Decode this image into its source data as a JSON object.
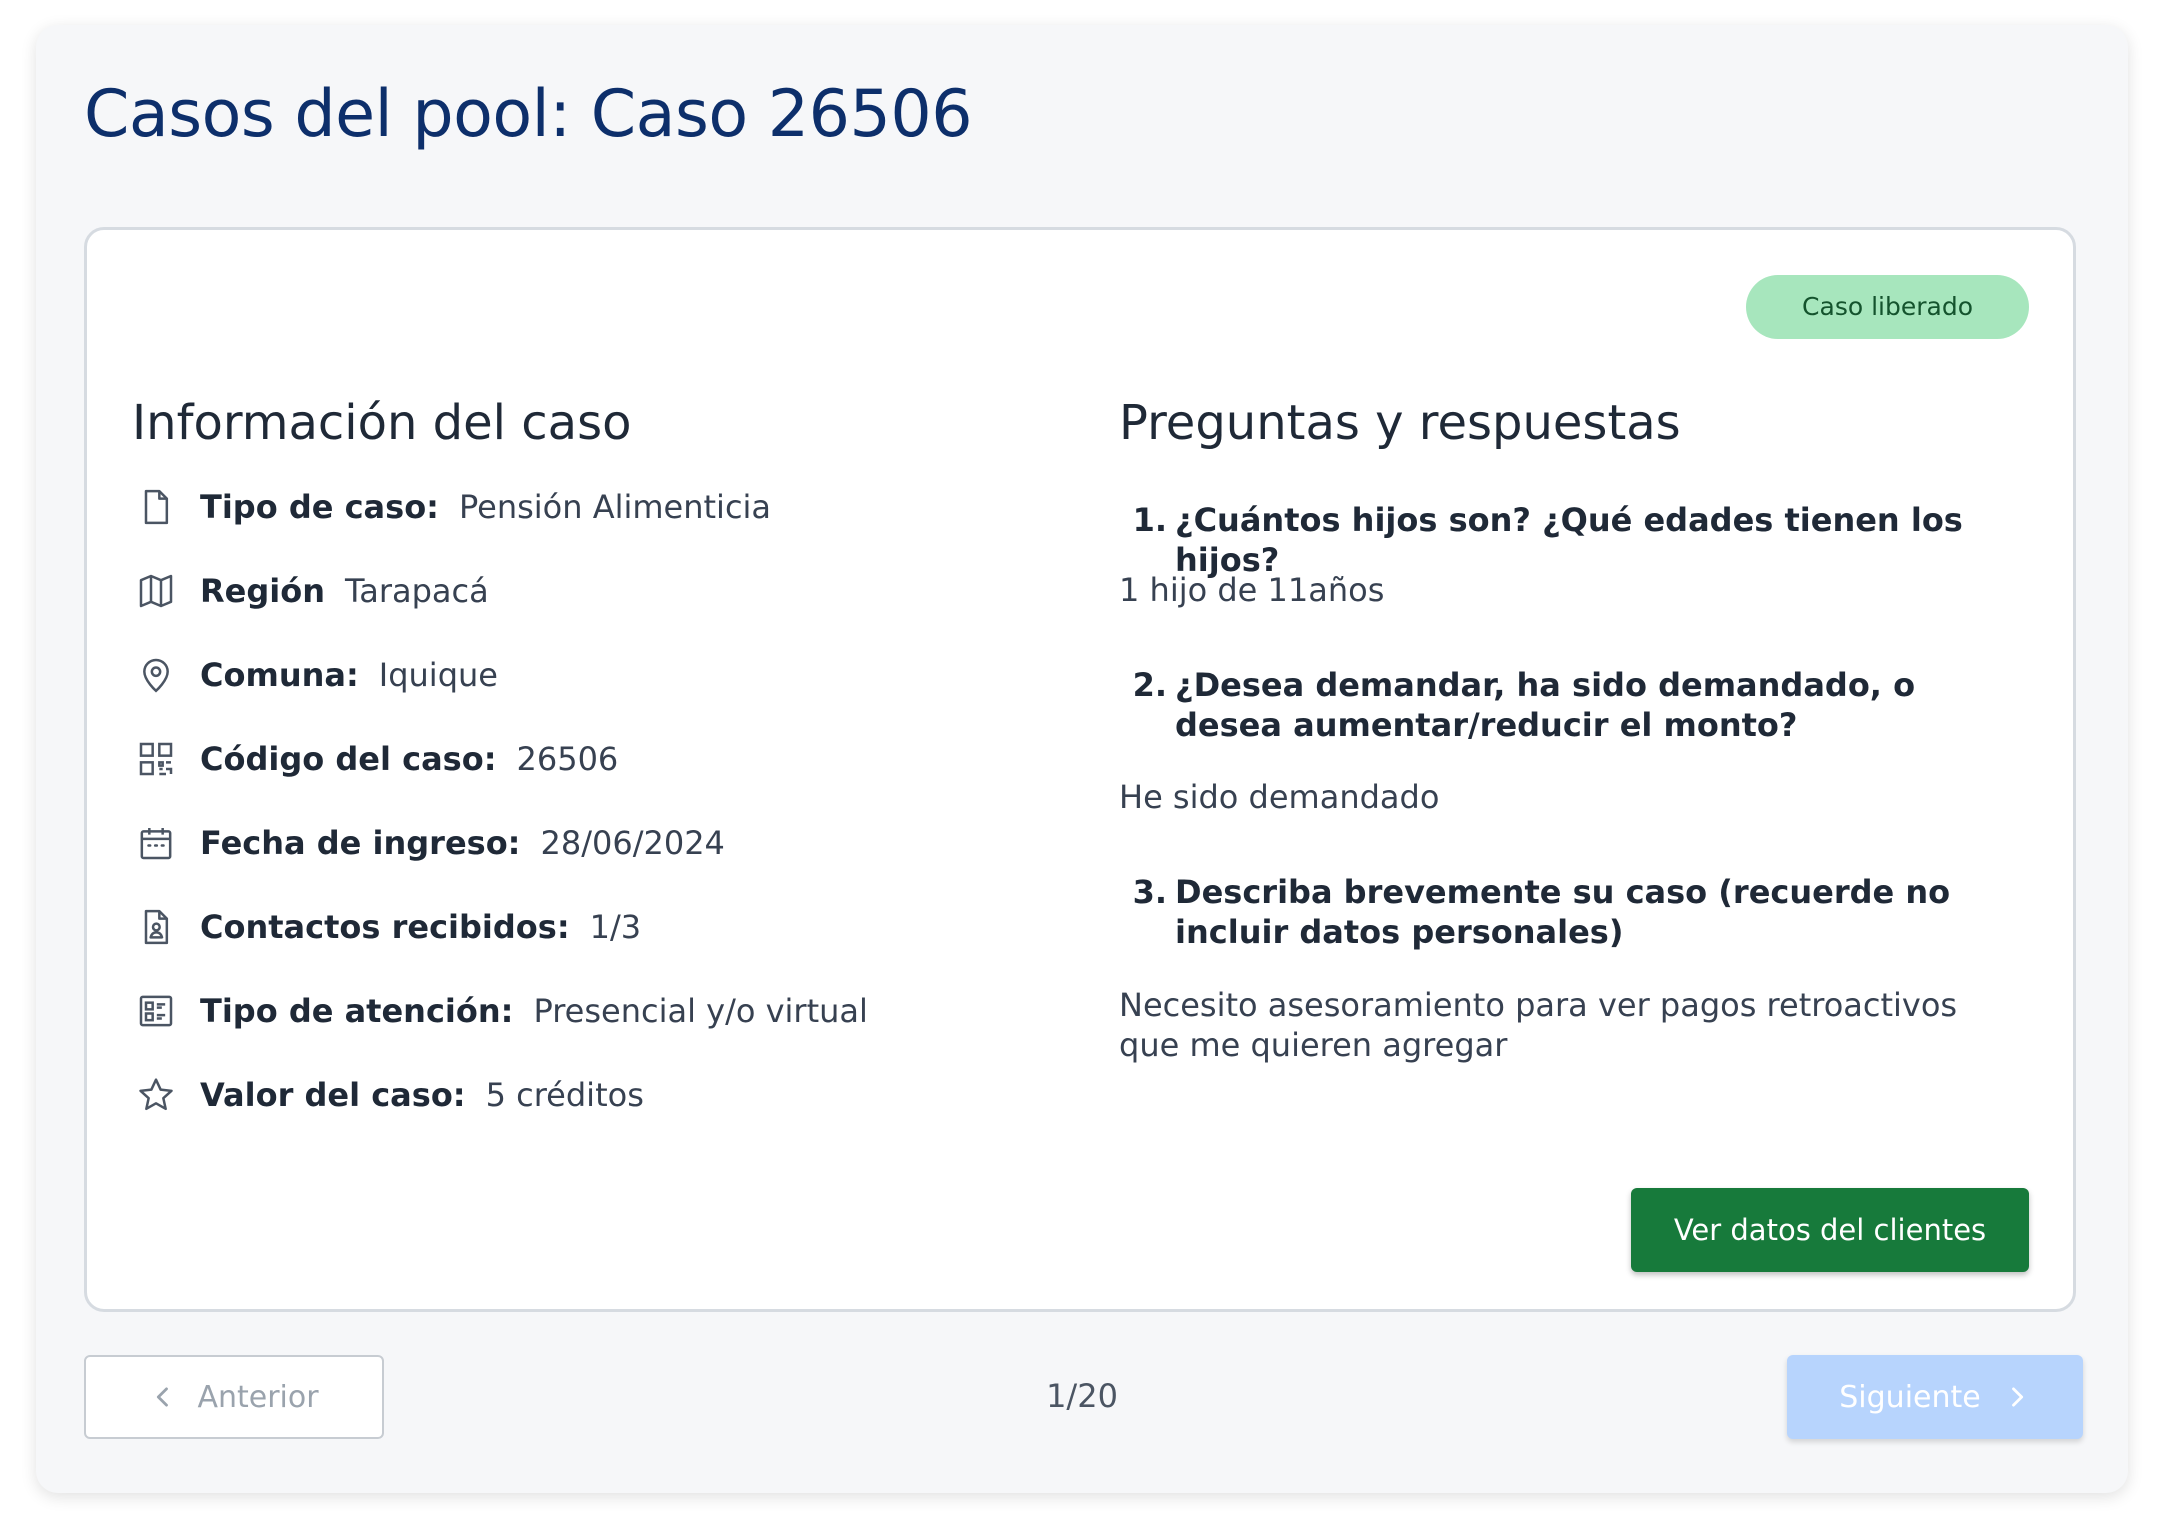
{
  "page": {
    "title": "Casos del pool: Caso 26506"
  },
  "status_badge": "Caso liberado",
  "info": {
    "heading": "Información del caso",
    "rows": [
      {
        "icon": "document-icon",
        "label": "Tipo de caso:",
        "value": "Pensión Alimenticia"
      },
      {
        "icon": "map-icon",
        "label": "Región",
        "value": "Tarapacá"
      },
      {
        "icon": "location-pin-icon",
        "label": "Comuna:",
        "value": "Iquique"
      },
      {
        "icon": "qr-code-icon",
        "label": "Código del caso:",
        "value": "26506"
      },
      {
        "icon": "calendar-icon",
        "label": "Fecha de ingreso:",
        "value": "28/06/2024"
      },
      {
        "icon": "contact-document-icon",
        "label": "Contactos recibidos:",
        "value": "1/3"
      },
      {
        "icon": "form-list-icon",
        "label": "Tipo de atención:",
        "value": "Presencial y/o virtual"
      },
      {
        "icon": "star-icon",
        "label": "Valor del caso:",
        "value": "5 créditos"
      }
    ]
  },
  "qa": {
    "heading": "Preguntas y respuestas",
    "items": [
      {
        "number": "1.",
        "question": "¿Cuántos hijos son? ¿Qué edades tienen los hijos?",
        "answer": "1 hijo de 11años"
      },
      {
        "number": "2.",
        "question": "¿Desea demandar, ha sido demandado, o desea aumentar/reducir el monto?",
        "answer": "He sido demandado"
      },
      {
        "number": "3.",
        "question": "Describa brevemente su caso (recuerde no incluir datos personales)",
        "answer": "Necesito asesoramiento para ver pagos retroactivos que me quieren agregar"
      }
    ]
  },
  "actions": {
    "view_client_label": "Ver datos del clientes"
  },
  "pagination": {
    "prev_label": "Anterior",
    "next_label": "Siguiente",
    "page_indicator": "1/20"
  },
  "colors": {
    "title": "#0d2f6b",
    "badge_bg": "#a7e6bd",
    "primary_button": "#177a3b",
    "next_button_disabled": "#b7d4fd",
    "card_border": "#d6dbe1"
  }
}
